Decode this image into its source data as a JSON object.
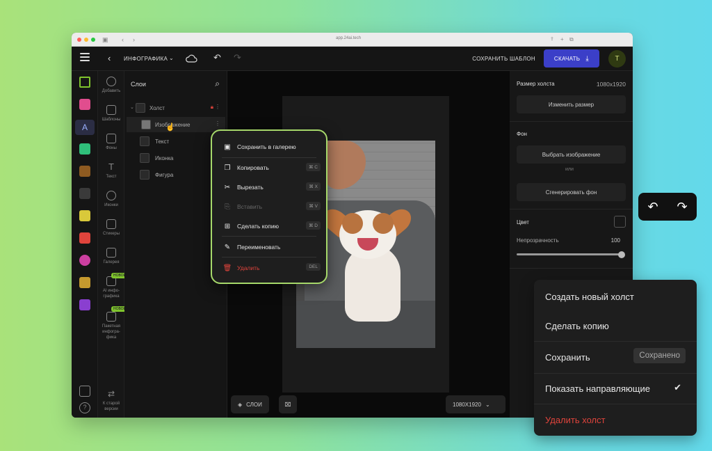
{
  "browser": {
    "url": "app.24ai.tech"
  },
  "topbar": {
    "project_title": "ИНФОГРАФИКА",
    "save_template": "СОХРАНИТЬ ШАБЛОН",
    "download": "СКАЧАТЬ",
    "avatar_initial": "T"
  },
  "tools": [
    {
      "label": "Добавить"
    },
    {
      "label": "Шаблоны"
    },
    {
      "label": "Фоны"
    },
    {
      "label": "Текст"
    },
    {
      "label": "Иконки"
    },
    {
      "label": "Стикеры"
    },
    {
      "label": "Галерея"
    },
    {
      "label": "AI инфо-графика",
      "badge": "НОВОЕ"
    },
    {
      "label": "Пакетная инфогра-фика",
      "badge": "НОВОЕ"
    },
    {
      "label": "К старой версии"
    }
  ],
  "layers": {
    "title": "Слои",
    "items": [
      "Холст",
      "Изображение",
      "Текст",
      "Иконка",
      "Фигура"
    ]
  },
  "canvas": {
    "layers_button": "СЛОИ",
    "size_select": "1080X1920"
  },
  "props": {
    "canvas_size_label": "Размер холста",
    "canvas_size_value": "1080x1920",
    "resize_button": "Изменить размер",
    "bg_label": "Фон",
    "choose_image": "Выбрать изображение",
    "or": "или",
    "generate_bg": "Сгенерировать фон",
    "color_label": "Цвет",
    "opacity_label": "Непрозрачность",
    "opacity_value": "100"
  },
  "context_menu": [
    {
      "label": "Сохранить в галерею",
      "icon": "save-icon",
      "shortcut": ""
    },
    {
      "label": "Копировать",
      "icon": "copy-icon",
      "shortcut": "⌘ C"
    },
    {
      "label": "Вырезать",
      "icon": "scissors-icon",
      "shortcut": "⌘ X"
    },
    {
      "label": "Вставить",
      "icon": "paste-icon",
      "shortcut": "⌘ V"
    },
    {
      "label": "Сделать копию",
      "icon": "duplicate-icon",
      "shortcut": "⌘ D"
    },
    {
      "label": "Переименовать",
      "icon": "pencil-icon",
      "shortcut": ""
    },
    {
      "label": "Удалить",
      "icon": "trash-icon",
      "shortcut": "DEL"
    }
  ],
  "canvas_menu": {
    "create": "Создать новый холст",
    "duplicate": "Сделать копию",
    "save": "Сохранить",
    "saved_badge": "Сохранено",
    "guides": "Показать направляющие",
    "delete": "Удалить холст"
  },
  "colors": {
    "accent": "#3b3fc8",
    "highlight": "#a6d86a",
    "danger": "#e0443c"
  }
}
